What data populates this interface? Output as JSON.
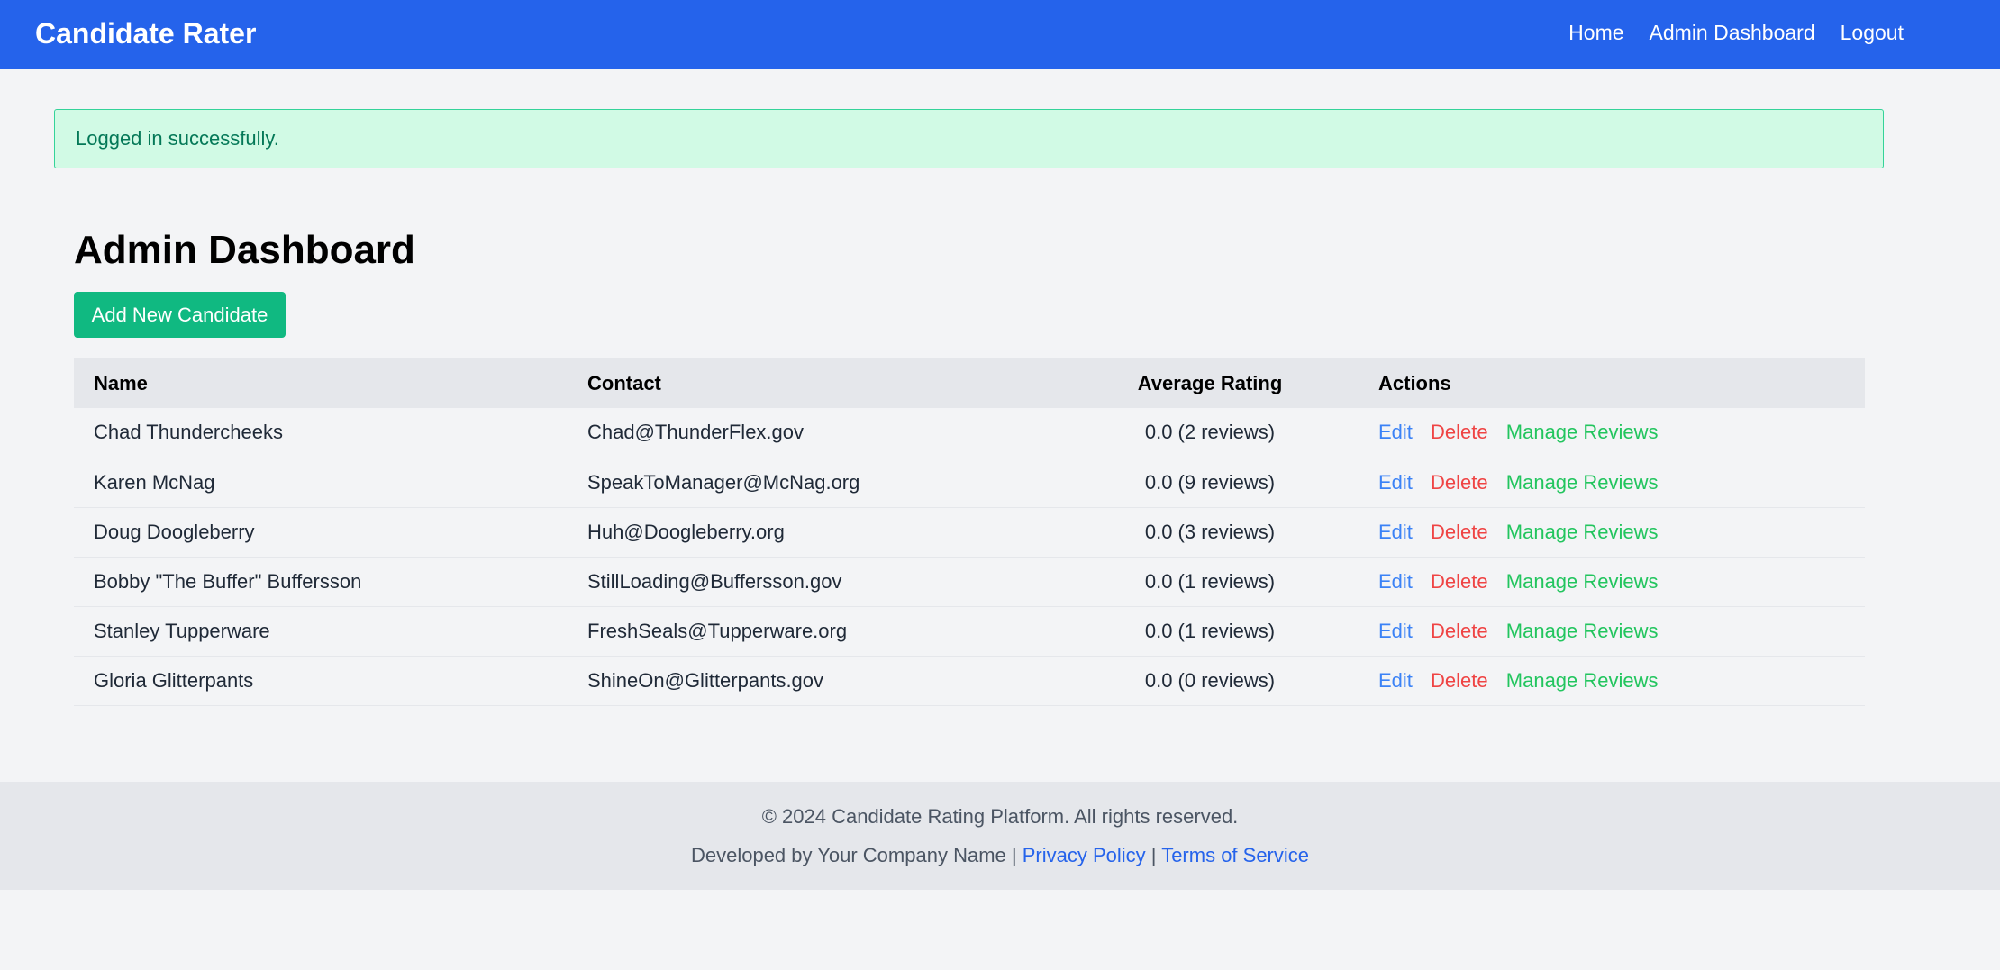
{
  "navbar": {
    "brand": "Candidate Rater",
    "links": [
      "Home",
      "Admin Dashboard",
      "Logout"
    ]
  },
  "flash": {
    "message": "Logged in successfully."
  },
  "main": {
    "title": "Admin Dashboard",
    "add_button": "Add New Candidate",
    "table": {
      "headers": [
        "Name",
        "Contact",
        "Average Rating",
        "Actions"
      ],
      "action_labels": {
        "edit": "Edit",
        "delete": "Delete",
        "manage": "Manage Reviews"
      },
      "rows": [
        {
          "name": "Chad Thundercheeks",
          "contact": "Chad@ThunderFlex.gov",
          "rating": "0.0 (2 reviews)"
        },
        {
          "name": "Karen McNag",
          "contact": "SpeakToManager@McNag.org",
          "rating": "0.0 (9 reviews)"
        },
        {
          "name": "Doug Doogleberry",
          "contact": "Huh@Doogleberry.org",
          "rating": "0.0 (3 reviews)"
        },
        {
          "name": "Bobby \"The Buffer\" Buffersson",
          "contact": "StillLoading@Buffersson.gov",
          "rating": "0.0 (1 reviews)"
        },
        {
          "name": "Stanley Tupperware",
          "contact": "FreshSeals@Tupperware.org",
          "rating": "0.0 (1 reviews)"
        },
        {
          "name": "Gloria Glitterpants",
          "contact": "ShineOn@Glitterpants.gov",
          "rating": "0.0 (0 reviews)"
        }
      ]
    }
  },
  "footer": {
    "copyright": "© 2024 Candidate Rating Platform. All rights reserved.",
    "developed_by": "Developed by Your Company Name |",
    "separator": "|",
    "privacy": "Privacy Policy",
    "terms": "Terms of Service"
  },
  "colors": {
    "navbar": "#2563eb",
    "success_bg": "#d1fae5",
    "success_border": "#34d399",
    "add_button": "#10b981",
    "edit": "#3b82f6",
    "delete": "#ef4444",
    "manage": "#22c55e"
  }
}
